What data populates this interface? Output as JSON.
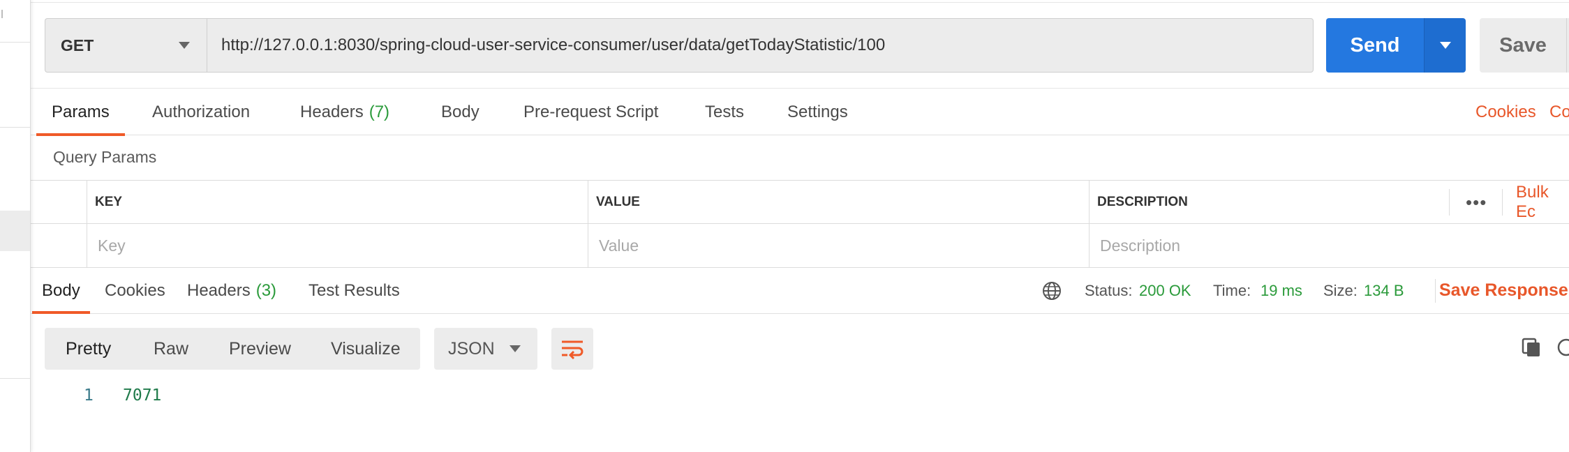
{
  "request": {
    "method": "GET",
    "url": "http://127.0.0.1:8030/spring-cloud-user-service-consumer/user/data/getTodayStatistic/100",
    "send_label": "Send",
    "save_label": "Save"
  },
  "request_tabs": [
    {
      "label": "Params",
      "count": ""
    },
    {
      "label": "Authorization",
      "count": ""
    },
    {
      "label": "Headers",
      "count": "(7)"
    },
    {
      "label": "Body",
      "count": ""
    },
    {
      "label": "Pre-request Script",
      "count": ""
    },
    {
      "label": "Tests",
      "count": ""
    },
    {
      "label": "Settings",
      "count": ""
    }
  ],
  "request_links": {
    "cookies": "Cookies",
    "code": "Co"
  },
  "query_params": {
    "title": "Query Params",
    "columns": [
      "KEY",
      "VALUE",
      "DESCRIPTION"
    ],
    "placeholders": [
      "Key",
      "Value",
      "Description"
    ],
    "more": "•••",
    "bulk_edit": "Bulk Ec"
  },
  "response_tabs": [
    {
      "label": "Body",
      "count": ""
    },
    {
      "label": "Cookies",
      "count": ""
    },
    {
      "label": "Headers",
      "count": "(3)"
    },
    {
      "label": "Test Results",
      "count": ""
    }
  ],
  "response_status": {
    "status_label": "Status:",
    "status_value": "200 OK",
    "time_label": "Time:",
    "time_value": "19 ms",
    "size_label": "Size:",
    "size_value": "134 B",
    "save_response": "Save Response"
  },
  "view_modes": [
    "Pretty",
    "Raw",
    "Preview",
    "Visualize"
  ],
  "format": "JSON",
  "response_body": [
    {
      "line": "1",
      "text": "7071"
    }
  ],
  "colors": {
    "accent": "#f05a28",
    "send": "#2478e0",
    "success": "#2a9a3a"
  }
}
